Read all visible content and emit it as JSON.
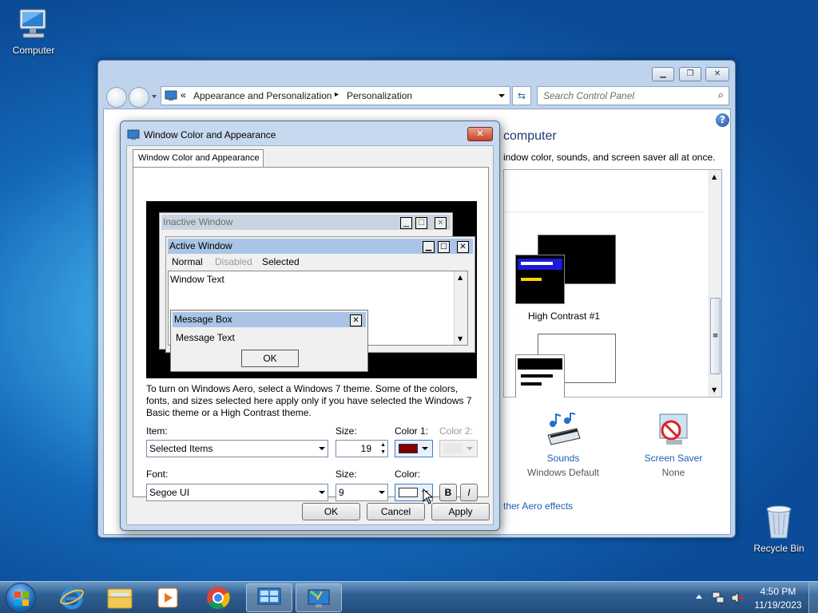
{
  "desktop": {
    "computer_label": "Computer",
    "recycle_label": "Recycle Bin"
  },
  "cp": {
    "breadcrumb_prefix": "«",
    "breadcrumb_1": "Appearance and Personalization",
    "breadcrumb_sep": "▸",
    "breadcrumb_2": "Personalization",
    "search_placeholder": "Search Control Panel",
    "heading_partial": "computer",
    "subtitle_partial": "indow color, sounds, and screen saver all at once.",
    "theme_label": "High Contrast #1",
    "sounds_label": "Sounds",
    "sounds_value": "Windows Default",
    "screensaver_label": "Screen Saver",
    "screensaver_value": "None",
    "aero_link": "ther Aero effects"
  },
  "dialog": {
    "title": "Window Color and Appearance",
    "tab": "Window Color and Appearance",
    "preview": {
      "inactive": "Inactive Window",
      "active": "Active Window",
      "menu_normal": "Normal",
      "menu_disabled": "Disabled",
      "menu_selected": "Selected",
      "window_text": "Window Text",
      "msgbox_title": "Message Box",
      "msgbox_text": "Message Text",
      "msgbox_ok": "OK"
    },
    "info": "To turn on Windows Aero, select a Windows 7 theme.  Some of the colors, fonts, and sizes selected here apply only if you have selected the Windows 7 Basic theme or a High Contrast theme.",
    "item_label": "Item:",
    "item_value": "Selected Items",
    "size_label": "Size:",
    "size_value": "19",
    "color1_label": "Color 1:",
    "color2_label": "Color 2:",
    "color1_value": "#800000",
    "font_label": "Font:",
    "font_value": "Segoe UI",
    "fontsize_label": "Size:",
    "fontsize_value": "9",
    "fontcolor_label": "Color:",
    "bold": "B",
    "italic": "I",
    "ok": "OK",
    "cancel": "Cancel",
    "apply": "Apply"
  },
  "tray": {
    "time": "4:50 PM",
    "date": "11/19/2023"
  },
  "colors": {
    "active_caption": "#a9c4e6",
    "inactive_caption": "#c9d4e2",
    "color1_swatch": "#800000"
  }
}
